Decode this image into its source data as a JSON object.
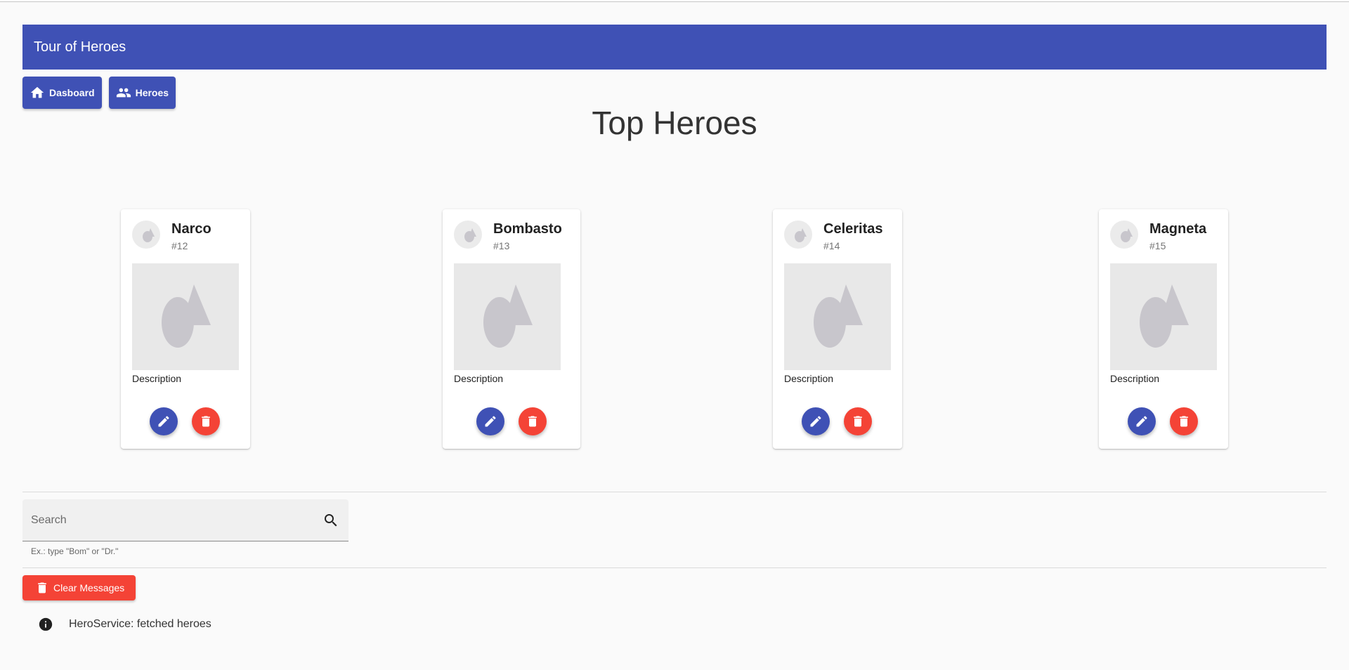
{
  "app": {
    "title": "Tour of Heroes"
  },
  "nav": {
    "dashboard": {
      "label": "Dasboard",
      "icon": "home-icon"
    },
    "heroes": {
      "label": "Heroes",
      "icon": "people-icon"
    }
  },
  "page": {
    "title": "Top Heroes"
  },
  "heroes": [
    {
      "name": "Narco",
      "id": "#12",
      "description": "Description"
    },
    {
      "name": "Bombasto",
      "id": "#13",
      "description": "Description"
    },
    {
      "name": "Celeritas",
      "id": "#14",
      "description": "Description"
    },
    {
      "name": "Magneta",
      "id": "#15",
      "description": "Description"
    }
  ],
  "search": {
    "placeholder": "Search",
    "value": "",
    "hint": "Ex.: type \"Bom\" or \"Dr.\""
  },
  "messages": {
    "clear_label": "Clear Messages",
    "items": [
      {
        "icon": "info-icon",
        "text": "HeroService: fetched heroes"
      }
    ]
  },
  "colors": {
    "primary": "#3f51b5",
    "warn": "#f44336",
    "background": "#fafafa"
  }
}
